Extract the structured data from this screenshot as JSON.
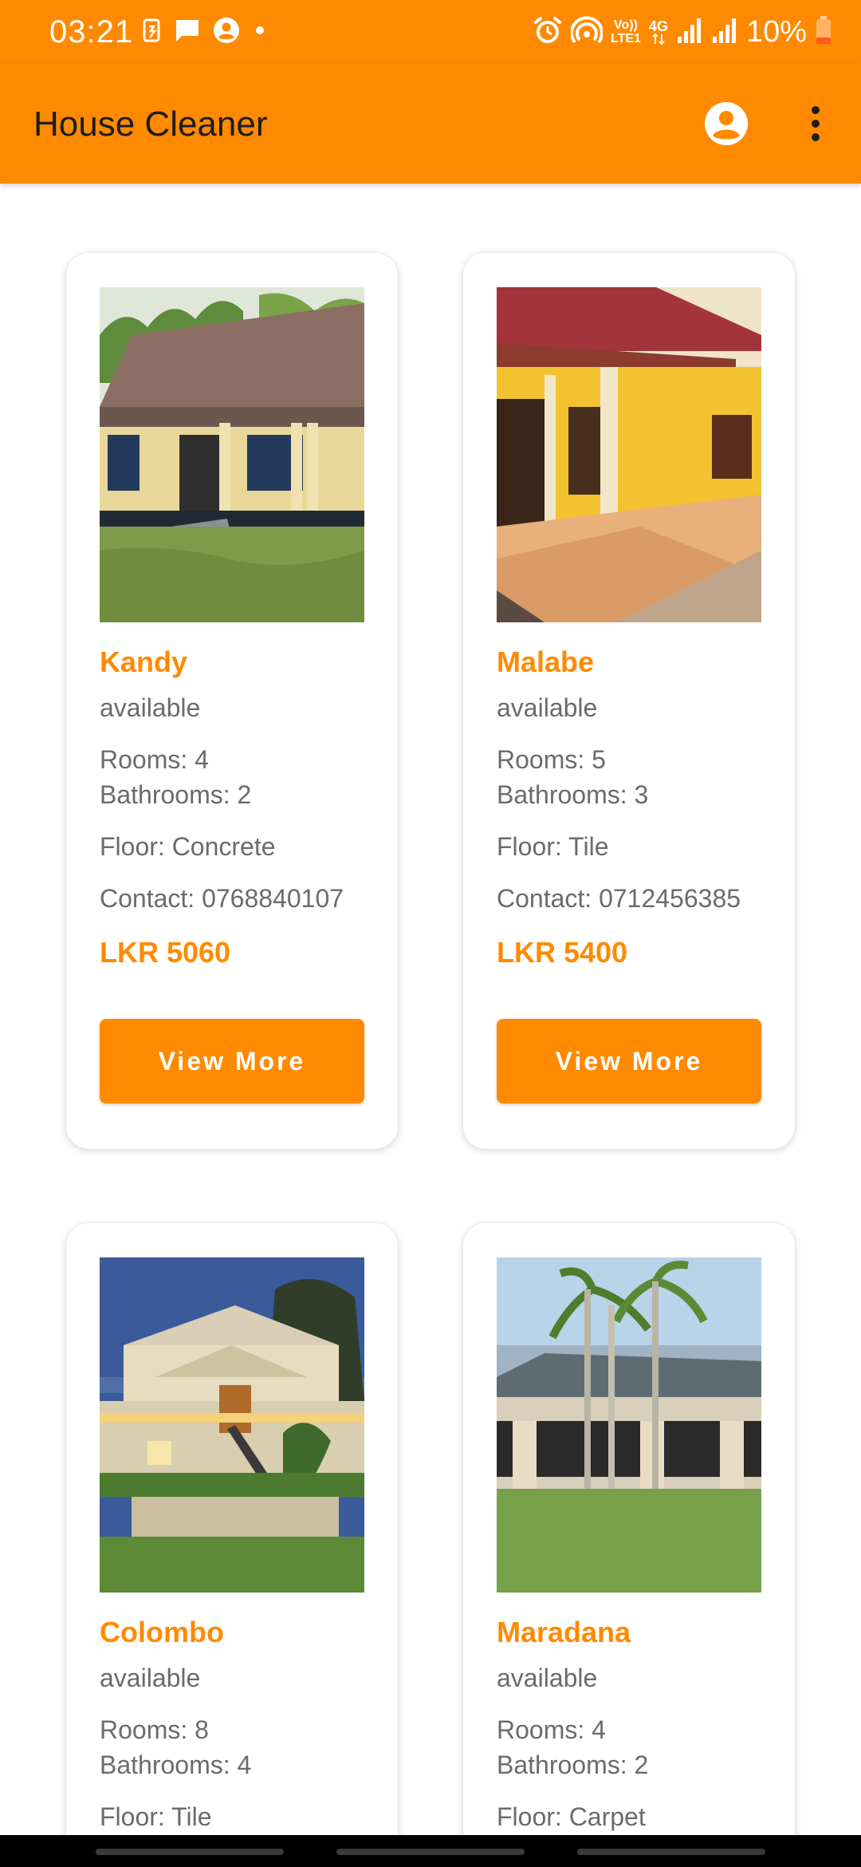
{
  "status_bar": {
    "time": "03:21",
    "volte_top": "Vo))",
    "volte_bottom": "LTE1",
    "network_type": "4G",
    "battery_percent": "10%"
  },
  "app_bar": {
    "title": "House Cleaner"
  },
  "listings": [
    {
      "city": "Kandy",
      "status": "available",
      "rooms": "Rooms: 4",
      "bathrooms": "Bathrooms: 2",
      "floor": "Floor: Concrete",
      "contact": "Contact: 0768840107",
      "price": "LKR 5060",
      "button": "View More"
    },
    {
      "city": "Malabe",
      "status": "available",
      "rooms": "Rooms: 5",
      "bathrooms": "Bathrooms: 3",
      "floor": "Floor: Tile",
      "contact": "Contact: 0712456385",
      "price": "LKR 5400",
      "button": "View More"
    },
    {
      "city": "Colombo",
      "status": "available",
      "rooms": "Rooms: 8",
      "bathrooms": "Bathrooms: 4",
      "floor": "Floor: Tile"
    },
    {
      "city": "Maradana",
      "status": "available",
      "rooms": "Rooms: 4",
      "bathrooms": "Bathrooms: 2",
      "floor": "Floor: Carpet"
    }
  ],
  "colors": {
    "accent": "#ff8a00",
    "text_secondary": "#6b6b6b",
    "title_text": "#1d1d1d"
  },
  "icons": [
    "data-saver-icon",
    "message-icon",
    "account-circle-icon",
    "alarm-icon",
    "hotspot-icon",
    "signal-icon",
    "battery-icon",
    "more-vert-icon"
  ]
}
